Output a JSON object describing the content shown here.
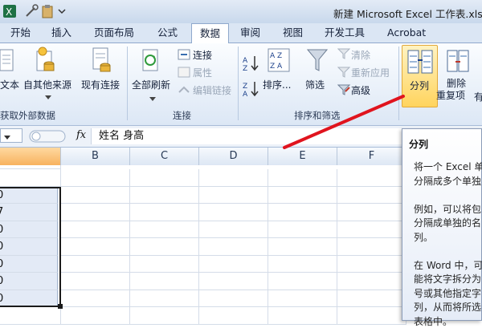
{
  "window": {
    "title": "新建 Microsoft Excel 工作表.xlsx"
  },
  "tabs": [
    {
      "label": "开始"
    },
    {
      "label": "插入"
    },
    {
      "label": "页面布局"
    },
    {
      "label": "公式"
    },
    {
      "label": "数据",
      "active": true
    },
    {
      "label": "审阅"
    },
    {
      "label": "视图"
    },
    {
      "label": "开发工具"
    },
    {
      "label": "Acrobat"
    }
  ],
  "ribbon": {
    "external": {
      "text_btn": "文本",
      "other_sources": "自其他来源",
      "existing_conn": "现有连接",
      "group_label": "获取外部数据"
    },
    "connections": {
      "refresh_all": "全部刷新",
      "connections": "连接",
      "properties": "属性",
      "edit_links": "编辑链接",
      "group_label": "连接"
    },
    "sort_filter": {
      "sort": "排序...",
      "filter": "筛选",
      "clear": "清除",
      "reapply": "重新应用",
      "advanced": "高级",
      "group_label": "排序和筛选"
    },
    "data_tools": {
      "text_to_columns": "分列",
      "remove_dup_line1": "删除",
      "remove_dup_line2": "重复项",
      "partial_label": "有"
    }
  },
  "formula_bar": {
    "fx": "fx",
    "content": "姓名 身高"
  },
  "columns": [
    "B",
    "C",
    "D",
    "E",
    "F"
  ],
  "cells_col_a": [
    "0",
    "7",
    "0",
    "0",
    "0",
    "0",
    "0"
  ],
  "tooltip": {
    "title": "分列",
    "lines": [
      "将一个 Excel 单",
      "分隔成多个单独",
      "",
      "例如，可以将包",
      "分隔成单独的名",
      "列。",
      "",
      "在 Word 中，可",
      "能将文字拆分为",
      "号或其他指定字",
      "列，从而将所选",
      "表格中。"
    ]
  },
  "colors": {
    "selected_tab": "#ffffff",
    "selected_button": "#ffd45e",
    "annotation_arrow": "#e0141e"
  }
}
